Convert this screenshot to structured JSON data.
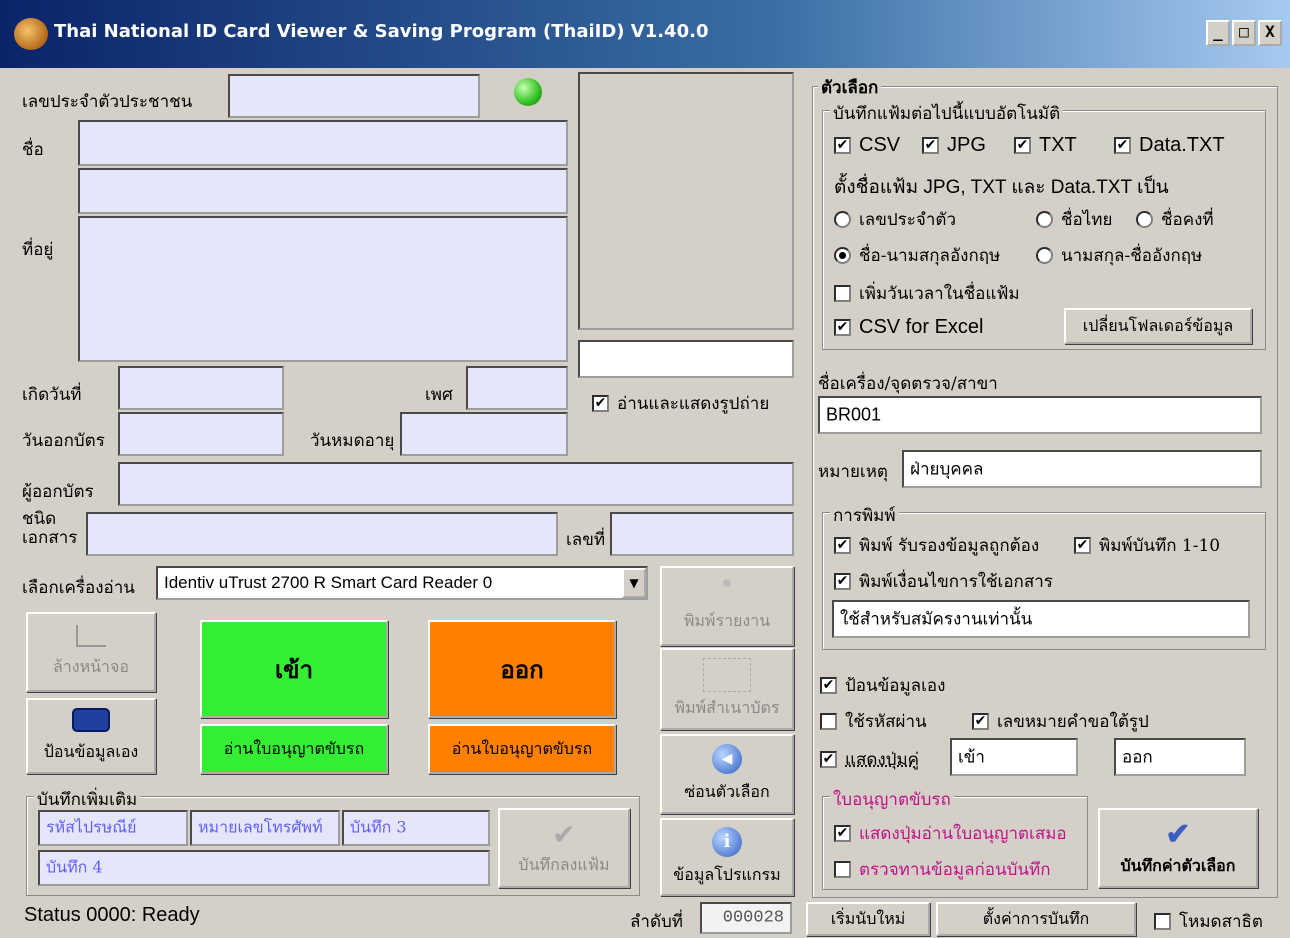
{
  "window": {
    "title": "Thai National ID Card Viewer & Saving Program (ThaiID) V1.40.0",
    "minimize": "_",
    "maximize": "□",
    "close": "X"
  },
  "form": {
    "id_label": "เลขประจำตัวประชาชน",
    "name_label": "ชื่อ",
    "address_label": "ที่อยู่",
    "birth_label": "เกิดวันที่",
    "sex_label": "เพศ",
    "issue_label": "วันออกบัตร",
    "expire_label": "วันหมดอายุ",
    "issuer_label": "ผู้ออกบัตร",
    "doctype_label": "ชนิด\nเอกสาร",
    "docno_label": "เลขที่",
    "reader_label": "เลือกเครื่องอ่าน",
    "reader_value": "Identiv uTrust 2700 R Smart Card Reader 0",
    "show_photo": "อ่านและแสดงรูปถ่าย"
  },
  "buttons": {
    "clear": "ล้างหน้าจอ",
    "manual": "ป้อนข้อมูลเอง",
    "enter": "เข้า",
    "exit": "ออก",
    "license_in": "อ่านใบอนุญาตขับรถ",
    "license_out": "อ่านใบอนุญาตขับรถ",
    "print_report": "พิมพ์รายงาน",
    "print_copy": "พิมพ์สำเนาบัตร",
    "hide_options": "ซ่อนตัวเลือก",
    "program_info": "ข้อมูลโปรแกรม",
    "save_to_file": "บันทึกลงแฟ้ม",
    "save_options": "บันทึกค่าตัวเลือก",
    "new_count": "เริ่มนับใหม่",
    "save_settings": "ตั้งค่าการบันทึก"
  },
  "extra": {
    "group": "บันทึกเพิ่มเติม",
    "f1": "รหัสไปรษณีย์",
    "f2": "หมายเลขโทรศัพท์",
    "f3": "บันทึก 3",
    "f4": "บันทึก 4"
  },
  "options": {
    "group": "ตัวเลือก",
    "autosave_group": "บันทึกแฟ้มต่อไปนี้แบบอัตโนมัติ",
    "csv": "CSV",
    "jpg": "JPG",
    "txt": "TXT",
    "datatxt": "Data.TXT",
    "naming_label": "ตั้งชื่อแฟ้ม JPG, TXT และ Data.TXT เป็น",
    "r_id": "เลขประจำตัว",
    "r_thai": "ชื่อไทย",
    "r_const": "ชื่อคงที่",
    "r_en_first": "ชื่อ-นามสกุลอังกฤษ",
    "r_en_last": "นามสกุล-ชื่ออังกฤษ",
    "add_datetime": "เพิ่มวันเวลาในชื่อแฟ้ม",
    "csv_excel": "CSV for Excel",
    "change_folder": "เปลี่ยนโฟลเดอร์ข้อมูล",
    "machine_label": "ชื่อเครื่อง/จุดตรวจ/สาขา",
    "machine_value": "BR001",
    "note_label": "หมายเหตุ",
    "note_value": "ฝ่ายบุคคล",
    "print_group": "การพิมพ์",
    "print_certify": "พิมพ์ รับรองข้อมูลถูกต้อง",
    "print_rec": "พิมพ์บันทึก 1-10",
    "print_cond": "พิมพ์เงื่อนไขการใช้เอกสาร",
    "cond_value": "ใช้สำหรับสมัครงานเท่านั้น",
    "manual_input": "ป้อนข้อมูลเอง",
    "use_password": "ใช้รหัสผ่าน",
    "photo_number": "เลขหมายคำขอใต้รูป",
    "show_btn": "แสดงปุ่มคู่",
    "show_btn_in": "เข้า",
    "show_btn_out": "ออก",
    "license_group": "ใบอนุญาตขับรถ",
    "license_always": "แสดงปุ่มอ่านใบอนุญาตเสมอ",
    "license_check": "ตรวจทานข้อมูลก่อนบันทึก",
    "demo_mode": "โหมดสาธิต"
  },
  "status": {
    "text": "Status 0000: Ready",
    "seq_label": "ลำดับที่",
    "seq_value": "000028"
  },
  "colors": {
    "field": "#e6e6fa",
    "green": "#33ee33",
    "orange": "#ff7f00",
    "accent_pink": "#c0138a"
  }
}
